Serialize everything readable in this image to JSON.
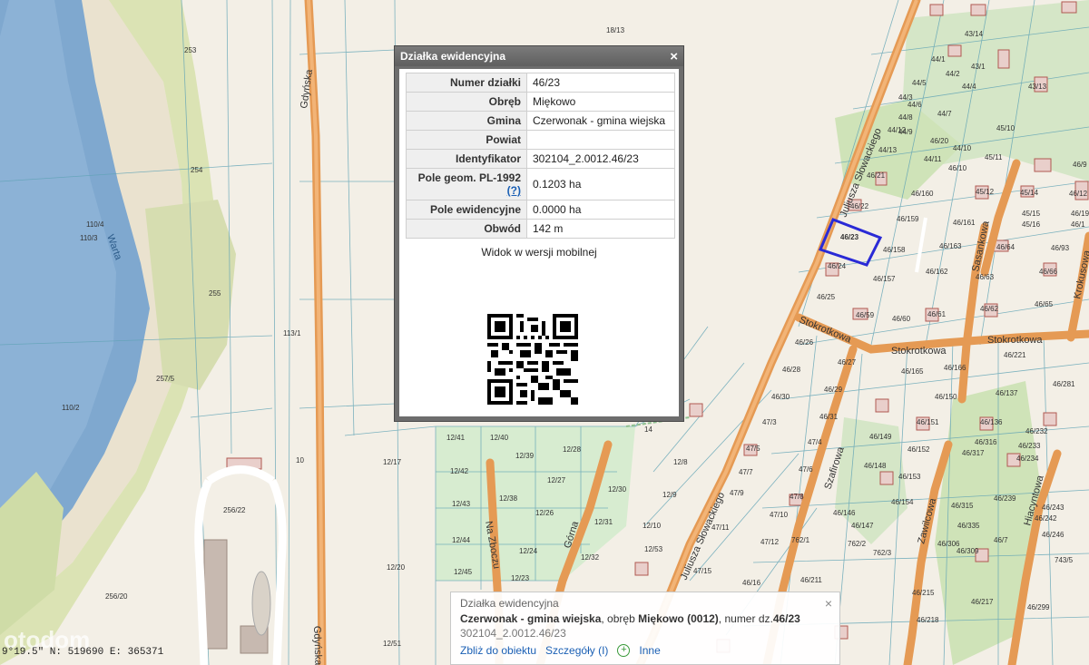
{
  "popup": {
    "title": "Działka ewidencyjna",
    "rows": [
      {
        "key": "Numer działki",
        "value": "46/23"
      },
      {
        "key": "Obręb",
        "value": "Miękowo"
      },
      {
        "key": "Gmina",
        "value": "Czerwonak - gmina wiejska"
      },
      {
        "key": "Powiat",
        "value": ""
      },
      {
        "key": "Identyfikator",
        "value": "302104_2.0012.46/23"
      },
      {
        "key": "Pole geom. PL-1992",
        "help": "(?)",
        "value": "0.1203 ha"
      },
      {
        "key": "Pole ewidencyjne",
        "value": "0.0000 ha"
      },
      {
        "key": "Obwód",
        "value": "142 m"
      }
    ],
    "mobile_label": "Widok w wersji mobilnej",
    "close_icon": "×"
  },
  "infobar": {
    "title": "Działka ewidencyjna",
    "line_gmina": "Czerwonak - gmina wiejska",
    "line_mid": ", obręb ",
    "line_obreb": "Miękowo (0012)",
    "line_tail": ", numer dz.",
    "line_number": "46/23",
    "identifier": "302104_2.0012.46/23",
    "link_zoom": "Zbliż do obiektu",
    "link_details": "Szczegóły (I)",
    "link_other": "Inne",
    "close_icon": "×"
  },
  "coords_text": "9°19.5\"  N: 519690  E: 365371",
  "watermark": "otodom",
  "streets": {
    "gdynska": "Gdyńska",
    "warta": "Warta",
    "slowackiego": "Juliusza Słowackiego",
    "stokrotkowa": "Stokrotkowa",
    "szafirowa": "Szafirowa",
    "zawilcowa": "Zawilcowa",
    "hiacyntowa": "Hiacyntowa",
    "krokusowa": "Krokusowa",
    "sasankowa": "Sasankowa",
    "gorna": "Górna",
    "na_zboczu": "Na Zboczu"
  },
  "parcels": [
    "253",
    "18/13",
    "254",
    "110/4",
    "110/3",
    "255",
    "113/1",
    "257/5",
    "110/2",
    "256/22",
    "256/20",
    "10",
    "12/17",
    "12/20",
    "12/51",
    "12/41",
    "12/40",
    "12/28",
    "12/42",
    "12/39",
    "12/27",
    "12/43",
    "12/38",
    "12/26",
    "12/44",
    "12/31",
    "12/45",
    "12/32",
    "12/23",
    "12/24",
    "14",
    "12/8",
    "12/30",
    "12/9",
    "12/10",
    "12/53",
    "47/11",
    "47/15",
    "46/16",
    "46/211",
    "46/23",
    "46/22",
    "46/21",
    "46/24",
    "46/25",
    "46/59",
    "46/60",
    "46/61",
    "46/159",
    "46/158",
    "46/157",
    "46/163",
    "46/162",
    "46/161",
    "46/160",
    "46/26",
    "46/27",
    "46/28",
    "46/29",
    "46/30",
    "46/31",
    "47/3",
    "47/4",
    "47/5",
    "47/6",
    "47/7",
    "47/8",
    "47/9",
    "47/10",
    "47/12",
    "762/1",
    "762/2",
    "762/3",
    "46/148",
    "46/146",
    "46/147",
    "46/149",
    "46/150",
    "46/151",
    "46/152",
    "46/153",
    "46/154",
    "46/165",
    "46/166",
    "46/137",
    "46/136",
    "46/317",
    "46/316",
    "46/315",
    "46/335",
    "46/309",
    "46/306",
    "46/215",
    "46/217",
    "46/218",
    "46/299",
    "46/232",
    "46/233",
    "46/234",
    "46/239",
    "46/242",
    "46/243",
    "46/246",
    "46/281",
    "46/221",
    "46/65",
    "46/62",
    "46/63",
    "46/64",
    "46/66",
    "46/93",
    "45/14",
    "45/15",
    "45/16",
    "45/11",
    "45/12",
    "45/10",
    "44/1",
    "44/2",
    "44/3",
    "44/4",
    "44/5",
    "44/6",
    "44/7",
    "44/8",
    "44/9",
    "44/10",
    "44/11",
    "44/12",
    "44/13",
    "43/1",
    "43/13",
    "43/14",
    "46/1",
    "46/10",
    "46/12",
    "46/19",
    "46/20",
    "743/5",
    "46/7",
    "46/9"
  ]
}
